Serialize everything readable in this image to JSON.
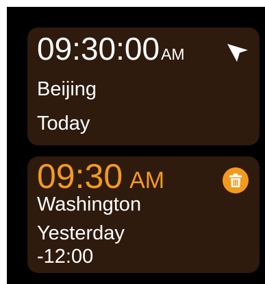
{
  "clocks": [
    {
      "time": "09:30:00",
      "ampm": "AM",
      "city": "Beijing",
      "day": "Today",
      "icon": "navigation-arrow-icon",
      "color": "#ffffff"
    },
    {
      "time": "09:30",
      "ampm": "AM",
      "city": "Washington",
      "day": "Yesterday",
      "offset": "-12:00",
      "icon": "trash-icon",
      "color": "#f39a1e"
    }
  ],
  "colors": {
    "background": "#000000",
    "card": "#2f1a0e",
    "accent": "#f39a1e",
    "text": "#ffffff"
  }
}
